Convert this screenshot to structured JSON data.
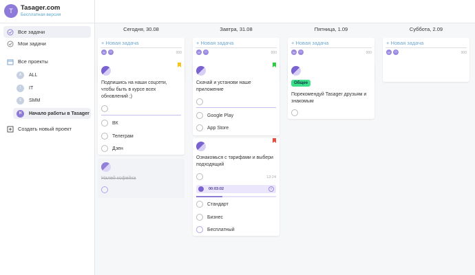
{
  "brand": {
    "logo_letter": "T",
    "title": "Tasager.com",
    "subtitle": "Бесплатная версия"
  },
  "nav": {
    "all_tasks": "Все задачи",
    "my_tasks": "Мои задачи",
    "all_projects": "Все проекты",
    "create_project": "Создать новый проект"
  },
  "projects": [
    {
      "letter": "A",
      "label": "ALL"
    },
    {
      "letter": "I",
      "label": "IT"
    },
    {
      "letter": "S",
      "label": "SMM"
    },
    {
      "letter": "Н",
      "label": "Начало работы в Tasager"
    }
  ],
  "columns": [
    {
      "title": "Сегодня, 30.08",
      "new_task": "Новая задача",
      "avatars": [
        "Н",
        "⚇"
      ],
      "more": "000"
    },
    {
      "title": "Завтра, 31.08",
      "new_task": "Новая задача",
      "avatars": [
        "Н",
        "⚇"
      ],
      "more": "000"
    },
    {
      "title": "Пятница, 1.09",
      "new_task": "Новая задача",
      "avatars": [
        "Н",
        "⚇"
      ],
      "more": "000"
    },
    {
      "title": "Суббота, 2.09",
      "new_task": "Новая задача",
      "avatars": [
        "Н",
        "⚇"
      ],
      "more": "000"
    }
  ],
  "cards": {
    "social": {
      "text": "Подпишись на наши соцсети, чтобы быть в курсе всех обновлений ;)",
      "flag_color": "#f5c518",
      "items": [
        "ВК",
        "Телеграм",
        "Дзен"
      ]
    },
    "coffee": {
      "text": "Налей кофейка"
    },
    "app": {
      "text": "Скачай и установи наше приложение",
      "flag_color": "#2ecc40",
      "items": [
        "Google Play",
        "App Store"
      ]
    },
    "tariffs": {
      "text": "Ознакомься с тарифами и выбери подходящий",
      "flag_color": "#e74c3c",
      "time": "13:24",
      "timer": "00:03:02",
      "progress": 0.33,
      "items": [
        "Стандарт",
        "Бизнес",
        "Бесплатный"
      ]
    },
    "recommend": {
      "tag": "Общее",
      "text": "Порекомендуй Tasager друзьям и знакомым"
    }
  },
  "colors": {
    "accent": "#8e7ad8",
    "tag": "#3ce08a",
    "link": "#6fa8d0"
  }
}
